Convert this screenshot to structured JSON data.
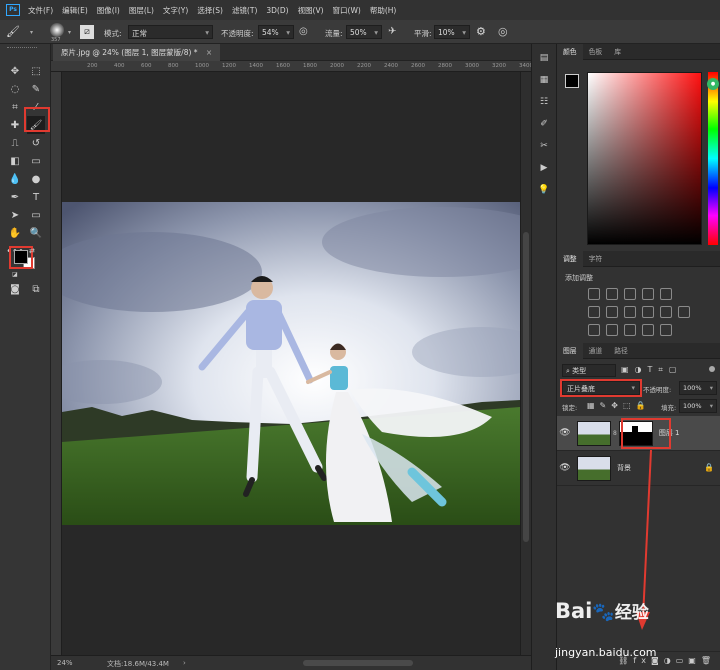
{
  "app": {
    "logo": "Ps"
  },
  "menu": [
    "文件(F)",
    "编辑(E)",
    "图像(I)",
    "图层(L)",
    "文字(Y)",
    "选择(S)",
    "滤镜(T)",
    "3D(D)",
    "视图(V)",
    "窗口(W)",
    "帮助(H)"
  ],
  "options": {
    "brush_size": "357",
    "mode_label": "模式:",
    "mode_value": "正常",
    "opacity_label": "不透明度:",
    "opacity_value": "54%",
    "flow_label": "流量:",
    "flow_value": "50%",
    "smooth_label": "平滑:",
    "smooth_value": "10%"
  },
  "document": {
    "tab_title": "原片.jpg @ 24% (图层 1, 图层蒙版/8) *",
    "ruler_ticks": [
      "200",
      "400",
      "600",
      "800",
      "1000",
      "1200",
      "1400",
      "1600",
      "1800",
      "2000",
      "2200",
      "2400",
      "2600",
      "2800",
      "3000",
      "3200",
      "3400"
    ],
    "zoom": "24%",
    "doc_info": "文档:18.6M/43.4M"
  },
  "panels": {
    "color_tabs": [
      "颜色",
      "色板",
      "库"
    ],
    "adjust_tabs": [
      "调整",
      "字符"
    ],
    "adjust_title": "添加调整",
    "layers_tabs": [
      "图层",
      "通道",
      "路径"
    ],
    "kind_filter": "类型",
    "blend_mode": "正片叠底",
    "opacity_label": "不透明度:",
    "opacity_value": "100%",
    "lock_label": "锁定:",
    "fill_label": "填充:",
    "fill_value": "100%",
    "layers": [
      {
        "name": "图层 1"
      },
      {
        "name": "背景"
      }
    ]
  },
  "watermark": {
    "brand": "Bai",
    "brand2": "经验",
    "url": "jingyan.baidu.com"
  },
  "colors": {
    "foreground": "#000000",
    "background": "#ffffff",
    "accent_red": "#e03a30",
    "ps_blue": "#31a8ff"
  }
}
